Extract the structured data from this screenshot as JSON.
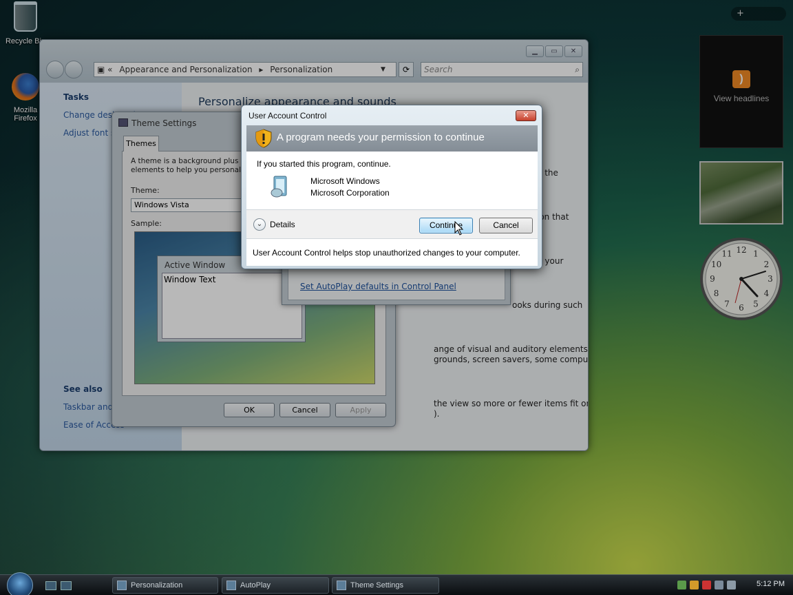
{
  "desktop": {
    "icons": [
      {
        "label": "Recycle Bin"
      },
      {
        "label": "Mozilla Firefox"
      }
    ]
  },
  "sidebar_gadgets": {
    "toolbar": "+",
    "feed_text": "View headlines",
    "clock_numbers": [
      "12",
      "1",
      "2",
      "3",
      "4",
      "5",
      "6",
      "7",
      "8",
      "9",
      "10",
      "11"
    ]
  },
  "control_panel": {
    "breadcrumb": [
      "Appearance and Personalization",
      "Personalization"
    ],
    "search_placeholder": "Search",
    "tasks_heading": "Tasks",
    "tasks": [
      "Change desktop icons",
      "Adjust font size (DPI)"
    ],
    "see_also_heading": "See also",
    "see_also": [
      "Taskbar and Start Menu",
      "Ease of Access"
    ],
    "heading": "Personalize appearance and sounds",
    "fragments": [
      "e the",
      "ion that",
      "g your",
      "ooks during such",
      "ange of visual and auditory elements at one time",
      "grounds, screen savers, some computer sounds,",
      "the view so more or fewer items fit on the screen.",
      ")."
    ]
  },
  "theme_settings": {
    "title": "Theme Settings",
    "tab": "Themes",
    "description": "A theme is a background plus a set of sounds, icons, and other elements to help you personalize your computer with one click.",
    "theme_label": "Theme:",
    "theme_value": "Windows Vista",
    "sample_label": "Sample:",
    "sample_window_title": "Active Window",
    "sample_window_text": "Window Text",
    "buttons": {
      "ok": "OK",
      "cancel": "Cancel",
      "apply": "Apply"
    }
  },
  "autoplay": {
    "link": "Set AutoPlay defaults in Control Panel"
  },
  "uac": {
    "title": "User Account Control",
    "banner": "A program needs your permission to continue",
    "prompt": "If you started this program, continue.",
    "program_name": "Microsoft Windows",
    "publisher": "Microsoft Corporation",
    "details": "Details",
    "continue": "Continue",
    "cancel": "Cancel",
    "footer": "User Account Control helps stop unauthorized changes to your computer."
  },
  "taskbar": {
    "buttons": [
      "Personalization",
      "AutoPlay",
      "Theme Settings"
    ],
    "clock": "5:12 PM"
  },
  "colors": {
    "uac_banner": "#8b939b",
    "continue_button": "#a7d8f6",
    "link": "#1b4f9c"
  }
}
